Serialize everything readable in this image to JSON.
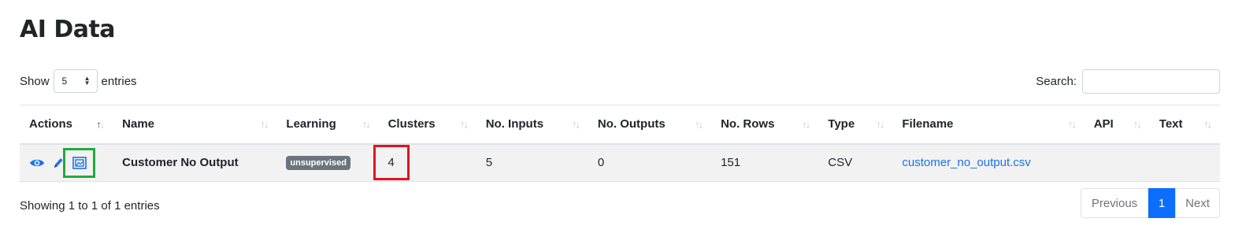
{
  "page": {
    "title": "AI Data"
  },
  "length": {
    "show_label": "Show",
    "value": "5",
    "entries_label": "entries"
  },
  "search": {
    "label": "Search:",
    "value": ""
  },
  "table": {
    "headers": [
      "Actions",
      "Name",
      "Learning",
      "Clusters",
      "No. Inputs",
      "No. Outputs",
      "No. Rows",
      "Type",
      "Filename",
      "API",
      "Text"
    ],
    "sorted_column": "Actions",
    "rows": [
      {
        "actions": [
          "eye-icon",
          "pencil-icon",
          "image-icon"
        ],
        "name": "Customer No Output",
        "learning": "unsupervised",
        "clusters": "4",
        "inputs": "5",
        "outputs": "0",
        "rows": "151",
        "type": "CSV",
        "filename": "customer_no_output.csv",
        "api": "",
        "text": ""
      }
    ]
  },
  "info": "Showing 1 to 1 of 1 entries",
  "pagination": {
    "previous": "Previous",
    "current": "1",
    "next": "Next"
  },
  "colors": {
    "link": "#1a73e8",
    "primary": "#0d6efd",
    "highlight_green": "#22aa3c",
    "highlight_red": "#e0141e",
    "badge": "#6c757d"
  }
}
